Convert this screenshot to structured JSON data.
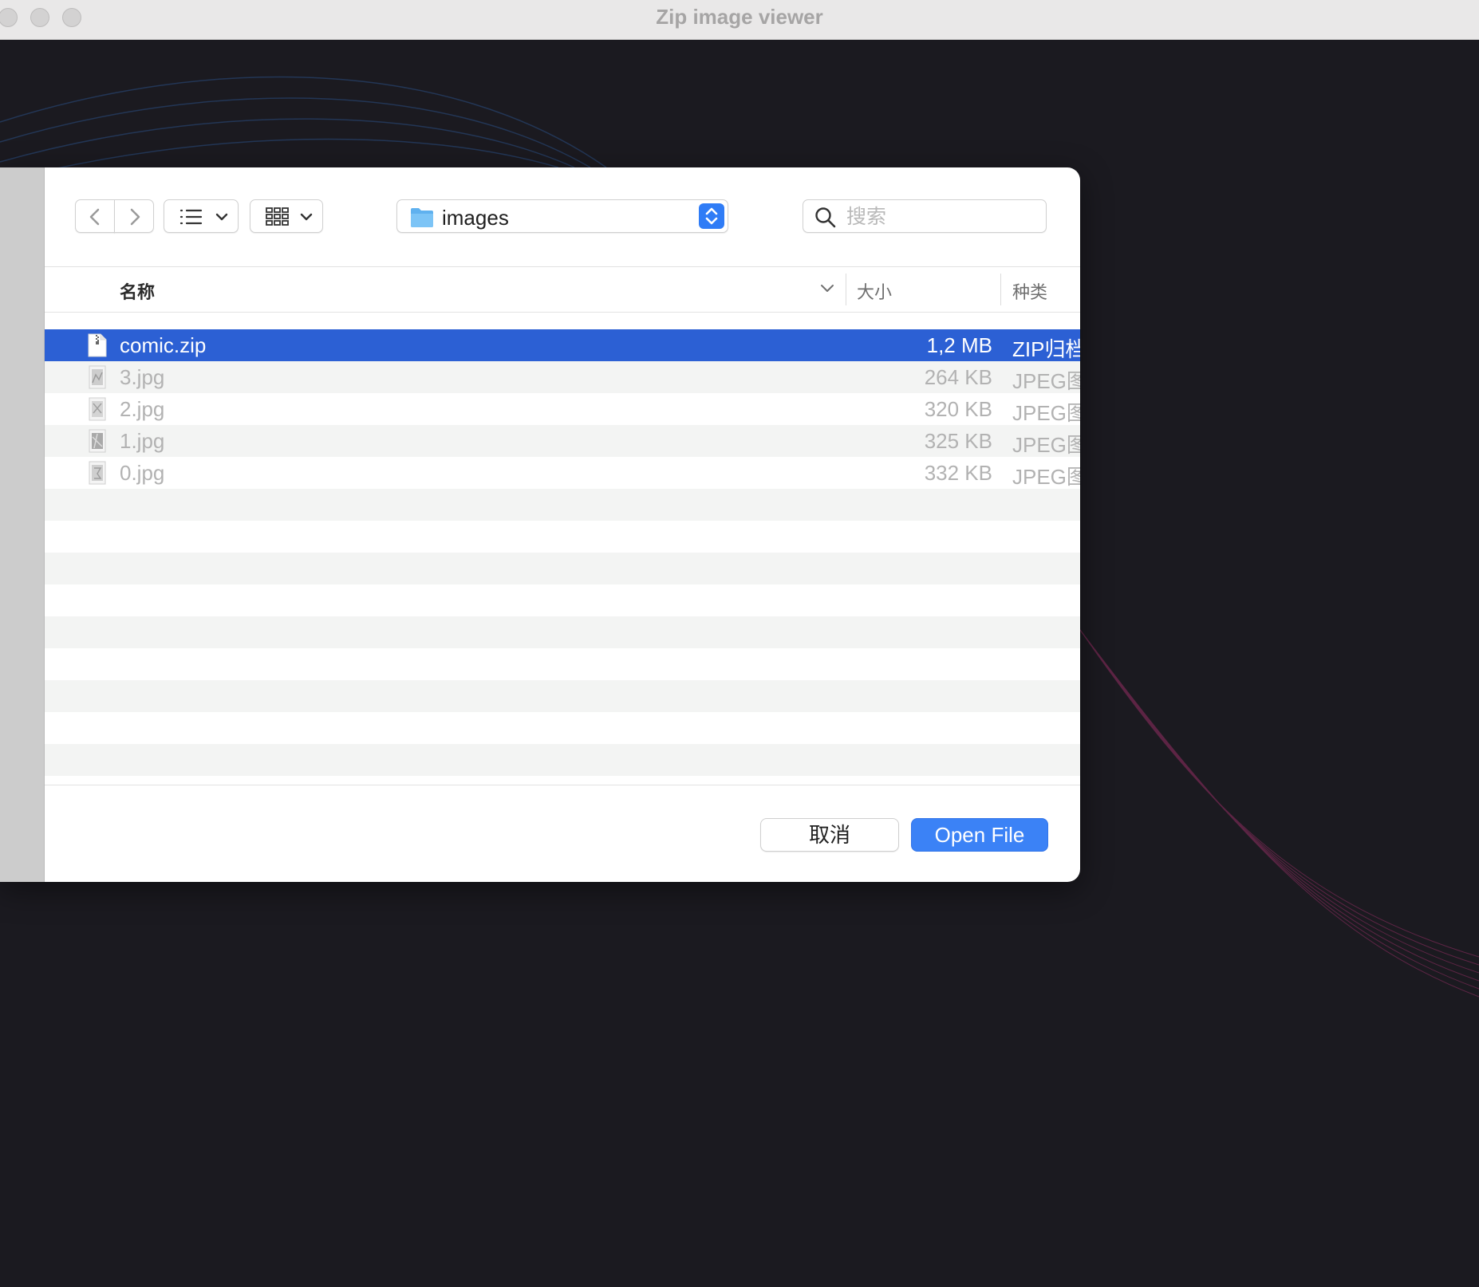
{
  "window": {
    "title": "Zip image viewer"
  },
  "toolbar": {
    "back_icon": "chevron-left-icon",
    "forward_icon": "chevron-right-icon",
    "list_view_icon": "list-icon",
    "grid_view_icon": "grid-icon",
    "current_folder": "images",
    "folder_icon": "folder-icon",
    "search_placeholder": "搜索",
    "search_value": ""
  },
  "columns": {
    "name": "名称",
    "size": "大小",
    "kind": "种类"
  },
  "files": [
    {
      "name": "comic.zip",
      "size": "1,2 MB",
      "kind": "ZIP归档",
      "icon": "zip-file-icon",
      "selected": true
    },
    {
      "name": "3.jpg",
      "size": "264 KB",
      "kind": "JPEG图",
      "icon": "image-file-icon",
      "selected": false
    },
    {
      "name": "2.jpg",
      "size": "320 KB",
      "kind": "JPEG图",
      "icon": "image-file-icon",
      "selected": false
    },
    {
      "name": "1.jpg",
      "size": "325 KB",
      "kind": "JPEG图",
      "icon": "image-file-icon",
      "selected": false
    },
    {
      "name": "0.jpg",
      "size": "332 KB",
      "kind": "JPEG图",
      "icon": "image-file-icon",
      "selected": false
    }
  ],
  "buttons": {
    "cancel": "取消",
    "open": "Open File"
  },
  "colors": {
    "selection": "#2c60d4",
    "primary_button": "#3b82f6",
    "background": "#1b1a20"
  }
}
